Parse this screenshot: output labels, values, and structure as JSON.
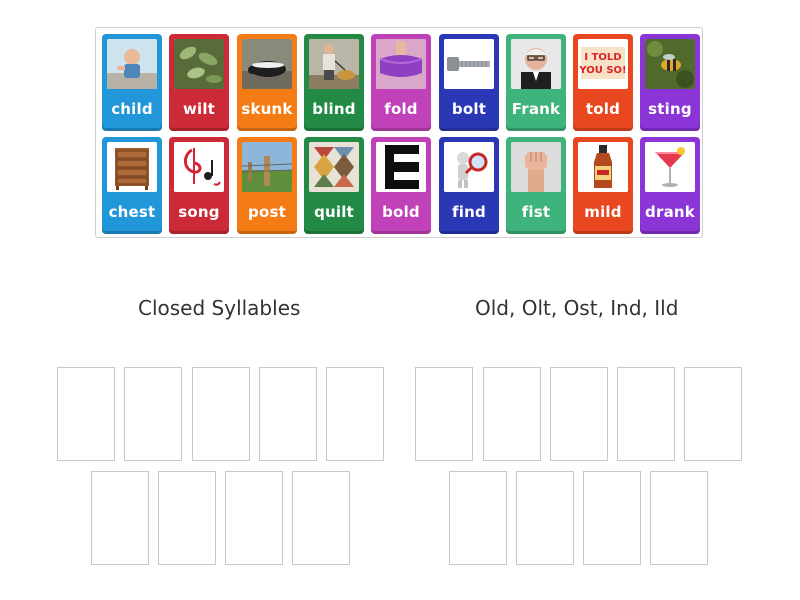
{
  "colors": {
    "blue": "#2196d8",
    "red": "#cc2a36",
    "orange": "#f57c14",
    "green": "#228a45",
    "magenta": "#c142b8",
    "navy": "#2a38b5",
    "teal": "#3eb37c",
    "tomato": "#e8471f",
    "purple": "#8c35d6"
  },
  "tiles": [
    {
      "word": "child",
      "color": "blue",
      "icon": "child-photo-icon"
    },
    {
      "word": "wilt",
      "color": "red",
      "icon": "wilted-plant-photo-icon"
    },
    {
      "word": "skunk",
      "color": "orange",
      "icon": "skunk-photo-icon"
    },
    {
      "word": "blind",
      "color": "green",
      "icon": "blind-man-with-dog-photo-icon"
    },
    {
      "word": "fold",
      "color": "magenta",
      "icon": "folded-cloth-photo-icon"
    },
    {
      "word": "bolt",
      "color": "navy",
      "icon": "bolt-photo-icon"
    },
    {
      "word": "Frank",
      "color": "teal",
      "icon": "man-portrait-photo-icon"
    },
    {
      "word": "told",
      "color": "tomato",
      "icon": "told-you-so-sign-icon"
    },
    {
      "word": "sting",
      "color": "purple",
      "icon": "bee-photo-icon"
    },
    {
      "word": "chest",
      "color": "blue",
      "icon": "chest-of-drawers-photo-icon"
    },
    {
      "word": "song",
      "color": "red",
      "icon": "music-notes-icon"
    },
    {
      "word": "post",
      "color": "orange",
      "icon": "fence-post-photo-icon"
    },
    {
      "word": "quilt",
      "color": "green",
      "icon": "quilt-photo-icon"
    },
    {
      "word": "bold",
      "color": "magenta",
      "icon": "bold-letter-e-icon"
    },
    {
      "word": "find",
      "color": "navy",
      "icon": "magnifying-glass-figure-icon"
    },
    {
      "word": "fist",
      "color": "teal",
      "icon": "raised-fist-photo-icon"
    },
    {
      "word": "mild",
      "color": "tomato",
      "icon": "sauce-bottle-photo-icon"
    },
    {
      "word": "drank",
      "color": "purple",
      "icon": "cocktail-glass-photo-icon"
    }
  ],
  "groups": [
    {
      "title": "Closed Syllables"
    },
    {
      "title": "Old, Olt, Ost, Ind, Ild"
    }
  ]
}
